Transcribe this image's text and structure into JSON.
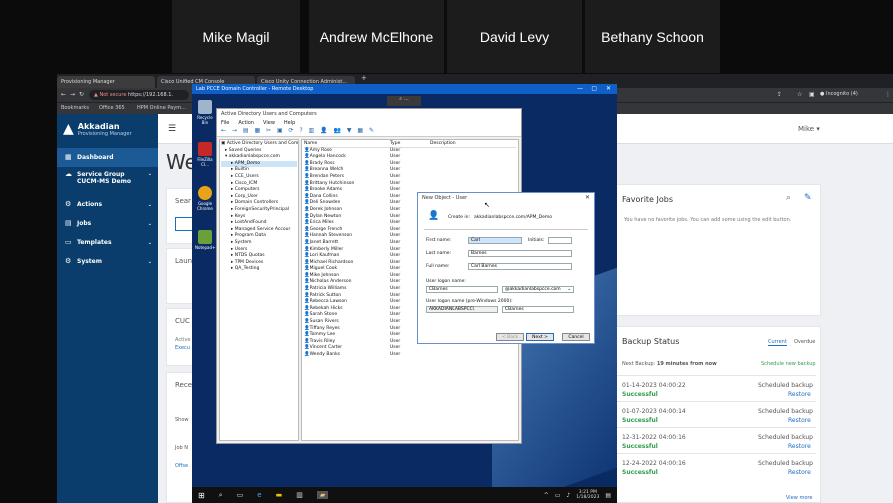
{
  "participants": [
    "Mike Magil",
    "Andrew McElhone",
    "David Levy",
    "Bethany Schoon"
  ],
  "browser": {
    "tabs": [
      "Provisioning Manager",
      "Cisco Unified CM Console",
      "Cisco Unity Connection Administ..."
    ],
    "new_tab": "+",
    "not_secure": "Not secure",
    "url": "https://192.168.1.",
    "bookmarks": [
      "Bookmarks",
      "Office 365",
      "HPM Online Paym..."
    ],
    "incognito": "Incognito (4)"
  },
  "app": {
    "brand": "Akkadian",
    "subtitle": "Provisioning Manager",
    "user": "Mike",
    "nav": [
      {
        "label": "Dashboard",
        "icon": "dashboard-icon"
      },
      {
        "label": "Service Group",
        "icon": "cloud-icon"
      },
      {
        "label": "Actions",
        "icon": "actions-icon"
      },
      {
        "label": "Jobs",
        "icon": "jobs-icon"
      },
      {
        "label": "Templates",
        "icon": "templates-icon"
      },
      {
        "label": "System",
        "icon": "system-icon"
      }
    ],
    "service_group_value": "CUCM-MS Demo",
    "welcome_text": "We",
    "partial": {
      "search": "Sear",
      "launch": "Laun",
      "cucm": "CUC",
      "active": "Active",
      "exec": "Execu",
      "recent": "Rece",
      "show": "Show",
      "job": "Job N",
      "offset": "Offse"
    },
    "favorite_jobs": {
      "title": "Favorite Jobs",
      "empty": "You have no favorite jobs. You can add some using the edit button."
    },
    "backup": {
      "title": "Backup Status",
      "tab_current": "Current",
      "tab_overdue": "Overdue",
      "next_prefix": "Next Backup:",
      "next_value": "19 minutes from now",
      "schedule_link": "Schedule new backup",
      "rows": [
        {
          "date": "01-14-2023 04:00:22",
          "status": "Successful",
          "type": "Scheduled backup",
          "action": "Restore"
        },
        {
          "date": "01-07-2023 04:00:14",
          "status": "Successful",
          "type": "Scheduled backup",
          "action": "Restore"
        },
        {
          "date": "12-31-2022 04:00:16",
          "status": "Successful",
          "type": "Scheduled backup",
          "action": "Restore"
        },
        {
          "date": "12-24-2022 04:00:16",
          "status": "Successful",
          "type": "Scheduled backup",
          "action": "Restore"
        }
      ],
      "view_more": "View more"
    }
  },
  "rdp": {
    "title": "Lab PCCE Domain Controller - Remote Desktop",
    "zoom": "⌕",
    "desktop_icons": [
      "Recycle Bin",
      "FileZilla Cl...",
      "Google Chrome",
      "Notepad++"
    ],
    "aduc": {
      "title": "Active Directory Users and Computers",
      "menu": [
        "File",
        "Action",
        "View",
        "Help"
      ],
      "tree": [
        "Active Directory Users and Com",
        "Saved Queries",
        "akkadianlabspcce.com",
        "APM_Demo",
        "Builtin",
        "CCE_Users",
        "Cisco_ICM",
        "Computers",
        "Corp_User",
        "Domain Controllers",
        "ForeignSecurityPrincipal",
        "Keys",
        "LostAndFound",
        "Managed Service Accour",
        "Program Data",
        "System",
        "Users",
        "NTDS Quotas",
        "TPM Devices",
        "QA_Testing"
      ],
      "columns": [
        "Name",
        "Type",
        "Description"
      ],
      "users": [
        "Amy Rose",
        "Angela Hancock",
        "Brady Ross",
        "Breanna Welch",
        "Brendan Peters",
        "Brittany Hutchinson",
        "Brooke Adams",
        "Dana Collins",
        "Deli Snowden",
        "Derek Johnson",
        "Dylan Newton",
        "Erica Miles",
        "George French",
        "Hannah Stevenson",
        "Janet Barrett",
        "Kimberly Miller",
        "Lori Kaufman",
        "Michael Richardson",
        "Miguel Cook",
        "Mike Johnson",
        "Nicholas Anderson",
        "Patricia Williams",
        "Patrick Sutton",
        "Rebecca Lawson",
        "Rebekah Hicks",
        "Sarah Stone",
        "Susan Rivers",
        "Tiffany Reyes",
        "Tommy Lee",
        "Travis Riley",
        "Vincent Carter",
        "Wendy Banks"
      ],
      "type_value": "User"
    },
    "dialog": {
      "title": "New Object - User",
      "create_in_label": "Create in:",
      "create_in_value": "akkadianlabspcce.com/APM_Demo",
      "first_name_label": "First name:",
      "first_name_value": "Carl",
      "initials_label": "Initials:",
      "last_name_label": "Last name:",
      "last_name_value": "Barnes",
      "full_name_label": "Full name:",
      "full_name_value": "Carl Barnes",
      "logon_label": "User logon name:",
      "logon_value": "CBarnes",
      "domain_value": "@akkadianlabspcce.com",
      "pre2000_label": "User logon name (pre-Windows 2000):",
      "pre2000_domain": "AKKADIANLABSPCC\\",
      "pre2000_value": "CBarnes",
      "back": "< Back",
      "next": "Next >",
      "cancel": "Cancel"
    },
    "clock": {
      "time": "3:21 PM",
      "date": "1/18/2023"
    }
  }
}
